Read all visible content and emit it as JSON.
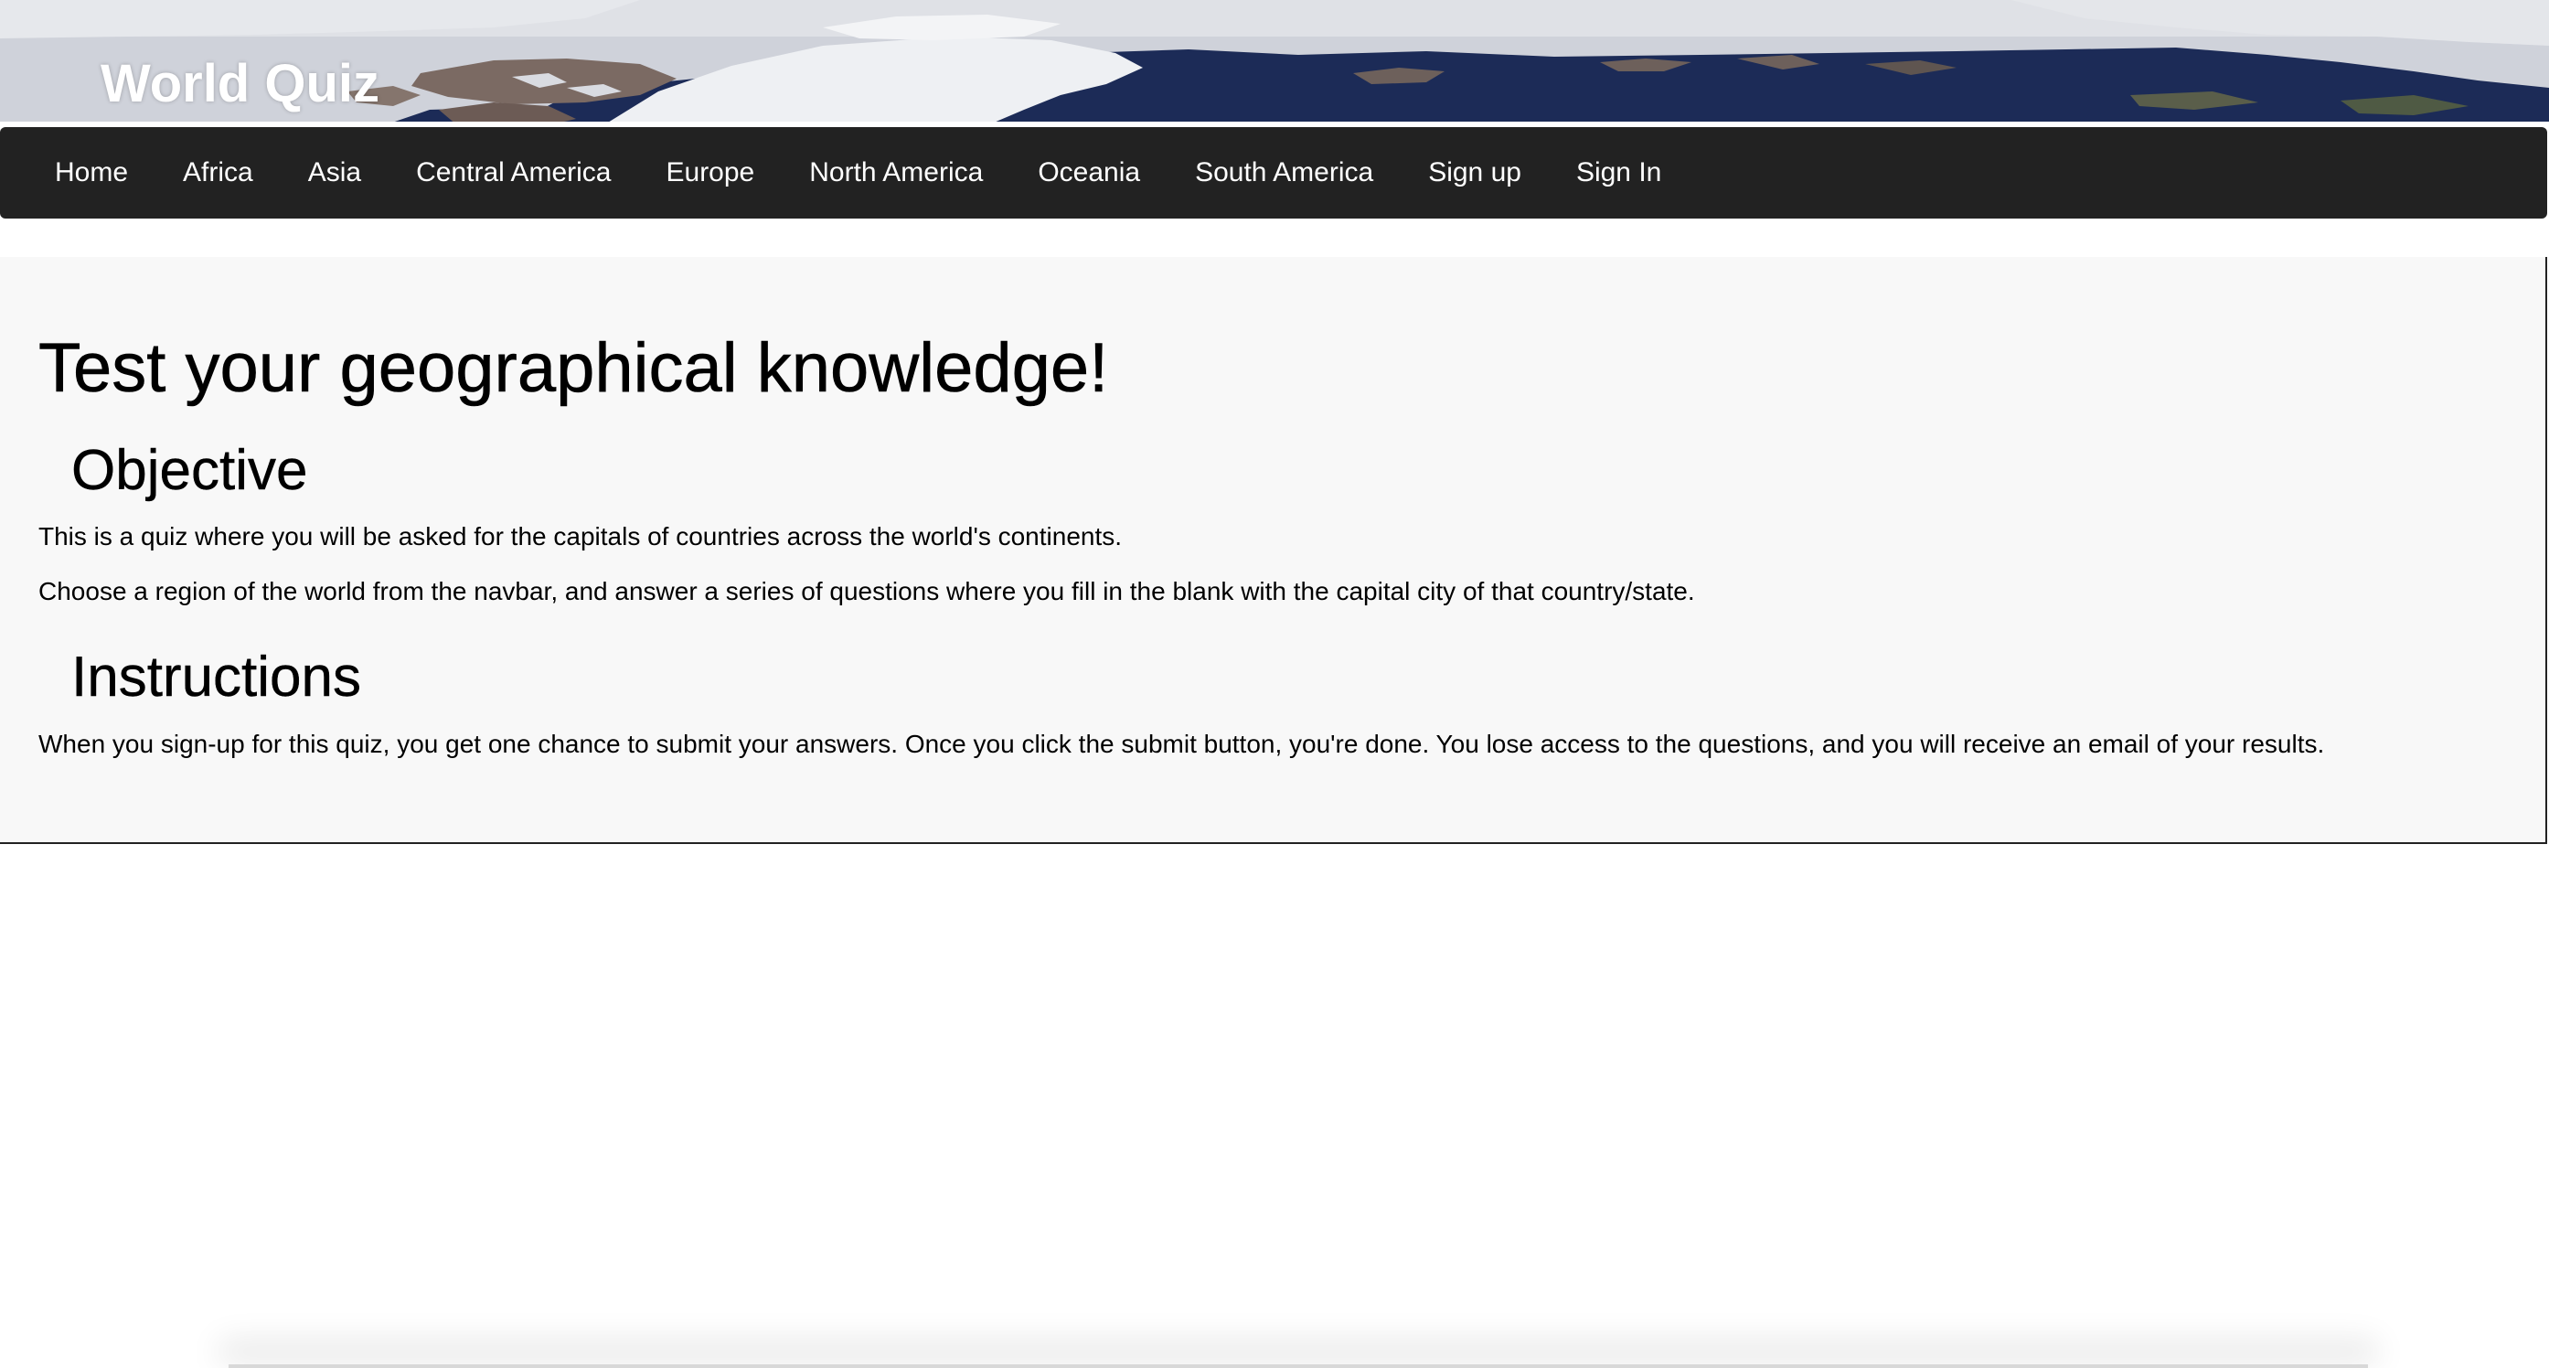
{
  "header": {
    "site_title": "World Quiz"
  },
  "navbar": {
    "items": [
      {
        "label": "Home"
      },
      {
        "label": "Africa"
      },
      {
        "label": "Asia"
      },
      {
        "label": "Central America"
      },
      {
        "label": "Europe"
      },
      {
        "label": "North America"
      },
      {
        "label": "Oceania"
      },
      {
        "label": "South America"
      },
      {
        "label": "Sign up"
      },
      {
        "label": "Sign In"
      }
    ]
  },
  "main": {
    "headline": "Test your geographical knowledge!",
    "objective": {
      "heading": "Objective",
      "paragraphs": [
        "This is a quiz where you will be asked for the capitals of countries across the world's continents.",
        "Choose a region of the world from the navbar, and answer a series of questions where you fill in the blank with the capital city of that country/state."
      ]
    },
    "instructions": {
      "heading": "Instructions",
      "paragraphs": [
        "When you sign-up for this quiz, you get one chance to submit your answers. Once you click the submit button, you're done. You lose access to the questions, and you will receive an email of your results."
      ]
    }
  },
  "colors": {
    "navbar_bg": "#222222",
    "jumbotron_bg": "#f8f8f8",
    "ocean": "#1a2a55",
    "ice": "#e9eaee"
  }
}
